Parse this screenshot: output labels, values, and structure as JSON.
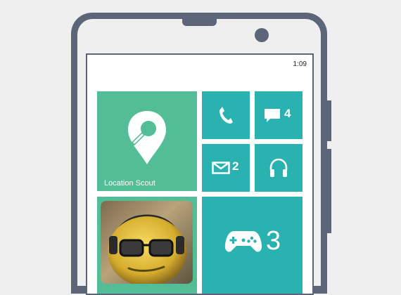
{
  "status_bar": {
    "time": "1:09"
  },
  "tiles": {
    "location": {
      "label": "Location Scout",
      "icon": "map-pin-search-icon",
      "color": "#52bd97"
    },
    "phone": {
      "icon": "phone-icon"
    },
    "messages": {
      "icon": "message-icon",
      "count": "4"
    },
    "mail": {
      "icon": "mail-icon",
      "count": "2"
    },
    "music": {
      "icon": "headphones-icon"
    },
    "photo": {
      "icon": "smiley-headphones-photo"
    },
    "games": {
      "icon": "gamepad-icon",
      "count": "3"
    }
  },
  "colors": {
    "tile": "#2ab2b0",
    "phone_body": "#5d6578",
    "background": "#efefef"
  }
}
